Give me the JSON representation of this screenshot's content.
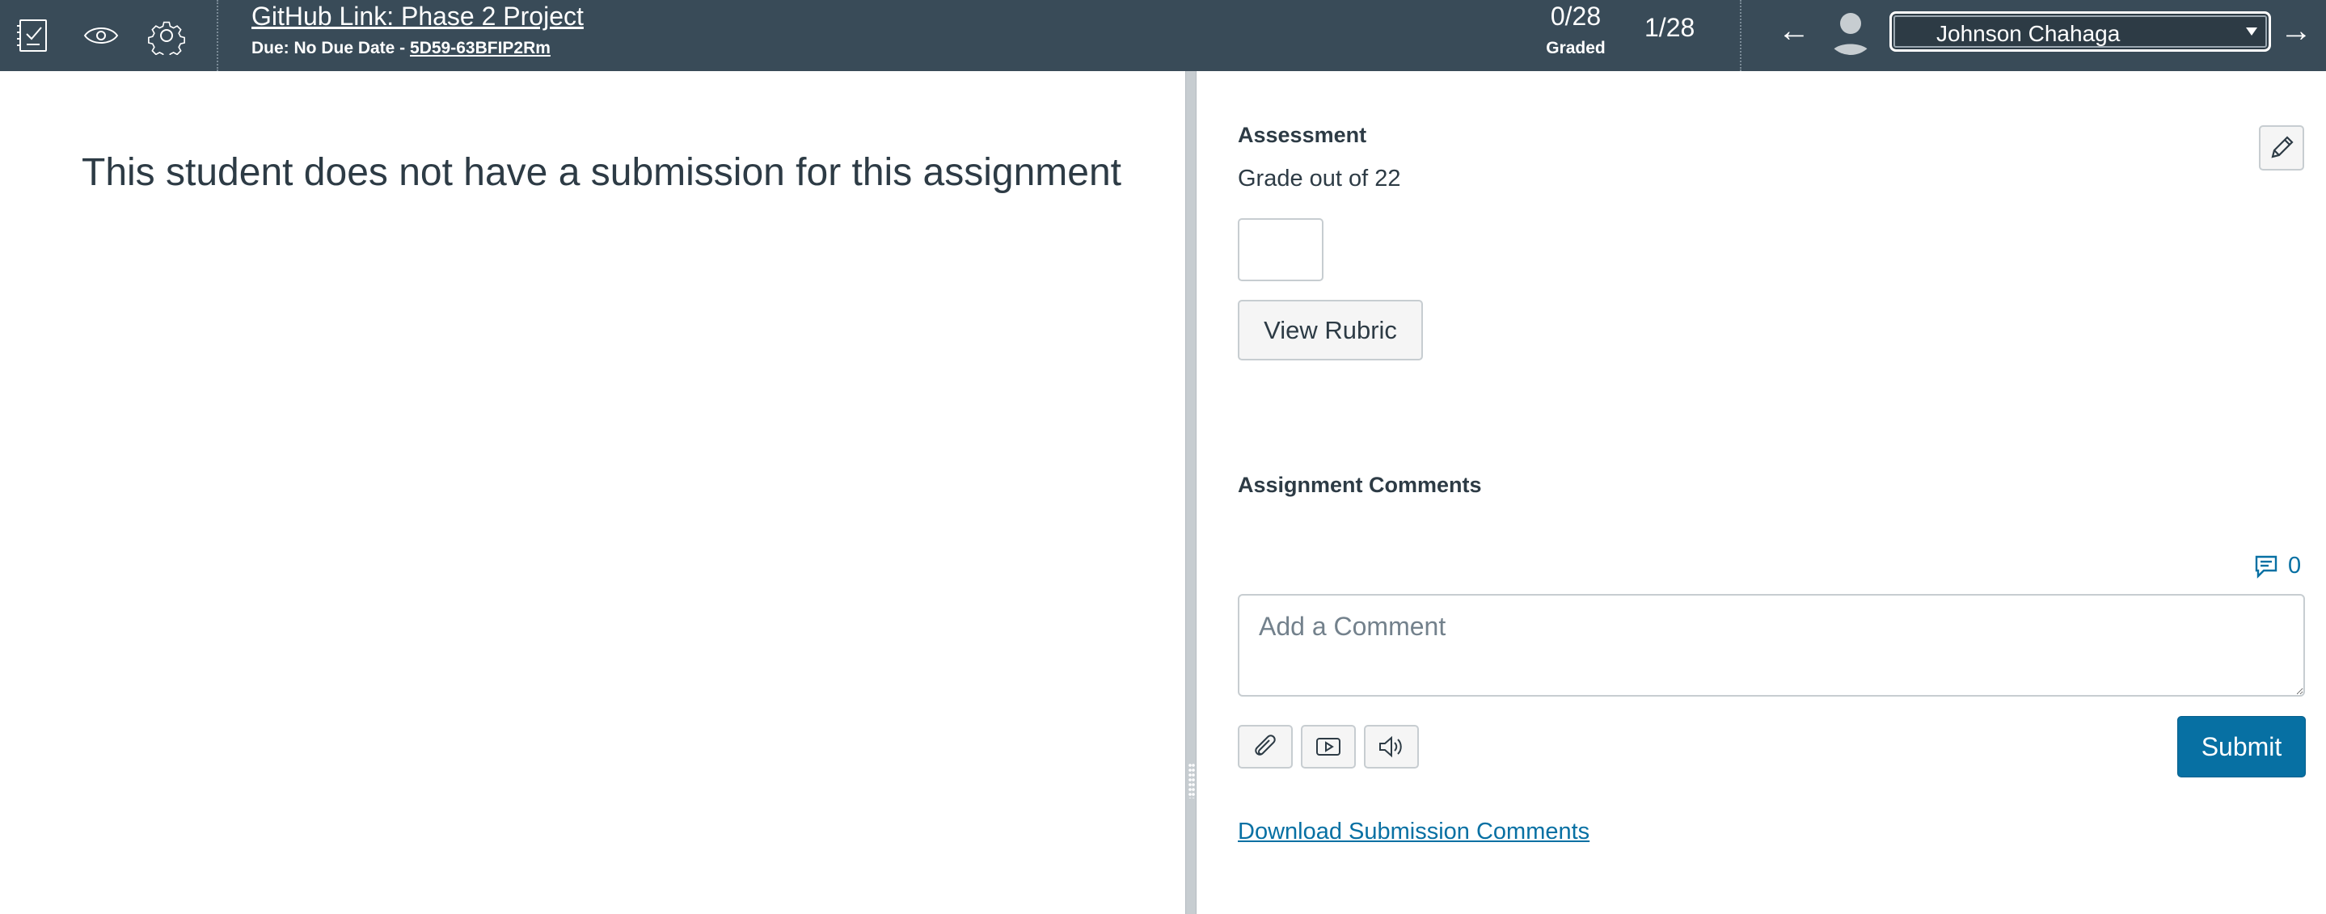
{
  "header": {
    "assignment_title": "GitHub Link: Phase 2 Project",
    "due_prefix": "Due: No Due Date - ",
    "anonymous_id": "5D59-63BFIP2Rm",
    "graded_count": "0/28",
    "graded_label": "Graded",
    "student_position": "1/28",
    "selected_student": "Johnson Chahaga",
    "icons": [
      "gradebook-icon",
      "eye-icon",
      "gear-icon",
      "arrow-left-icon",
      "avatar-icon",
      "arrow-right-icon"
    ]
  },
  "left_pane": {
    "message": "This student does not have a submission for this assignment"
  },
  "assessment": {
    "title": "Assessment",
    "grade_out_of": "Grade out of 22",
    "grade_value": "",
    "view_rubric_label": "View Rubric",
    "edit_icon": "pencil-icon"
  },
  "comments": {
    "title": "Assignment Comments",
    "count": "0",
    "placeholder": "Add a Comment",
    "value": "",
    "submit_label": "Submit",
    "download_link": "Download Submission Comments",
    "media_icons": [
      "paperclip-icon",
      "video-icon",
      "audio-icon"
    ]
  },
  "colors": {
    "header_bg": "#394b58",
    "accent": "#0770a3",
    "text": "#2d3b45",
    "border": "#c7cdd1"
  }
}
